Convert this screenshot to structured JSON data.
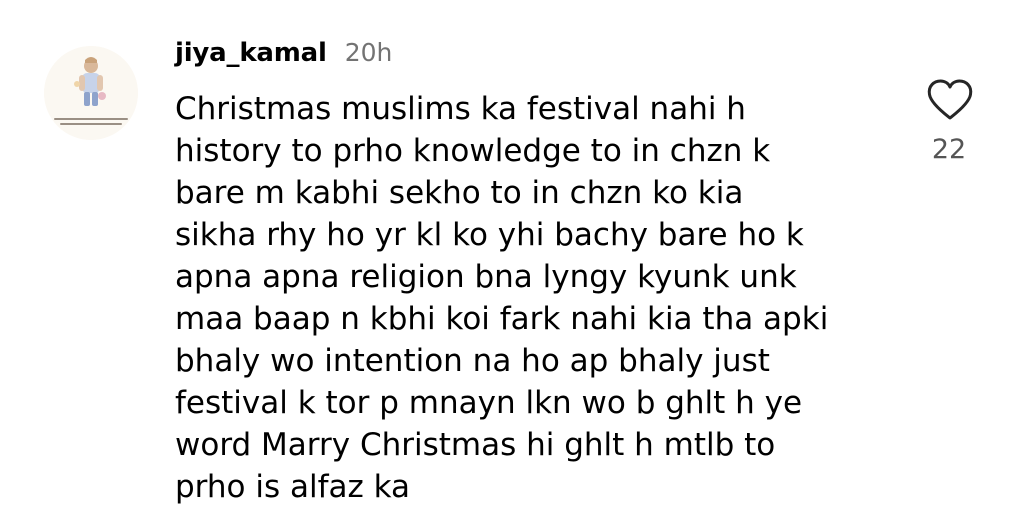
{
  "comment": {
    "username": "jiya_kamal",
    "timestamp": "20h",
    "text": "Christmas muslims ka festival nahi h\nhistory to prho knowledge to in chzn k\nbare m kabhi sekho to in chzn ko kia\nsikha rhy ho yr kl ko yhi bachy bare ho k\napna apna religion bna lyngy kyunk unk\nmaa baap n kbhi koi fark nahi kia tha apki\nbhaly wo intention na ho ap bhaly just\nfestival k tor p mnayn lkn wo b ghlt h ye\nword Marry Christmas hi ghlt h mtlb to\nprho is alfaz ka",
    "like_count": "22",
    "like_icon": "heart-outline-icon"
  },
  "colors": {
    "text": "#000000",
    "timestamp": "#737373",
    "like_count": "#555555",
    "icon_stroke": "#262626"
  }
}
